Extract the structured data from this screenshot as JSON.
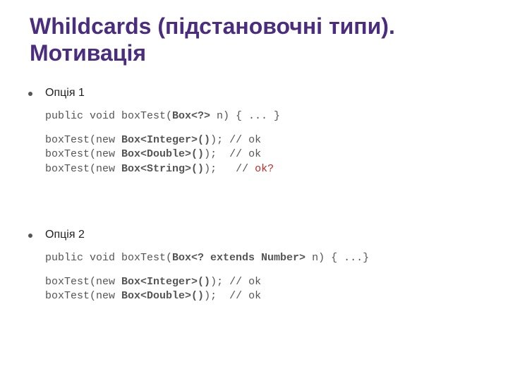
{
  "title": "Whildcards (підстановочні типи). Мотивація",
  "opt1": {
    "label": "Опція 1",
    "sig_pre": "public void boxTest(",
    "sig_bold": "Box<?>",
    "sig_post": " n) { ... }",
    "l1_pre": "boxTest(new ",
    "l1_bold": "Box<Integer>()",
    "l1_post": "); // ok",
    "l2_pre": "boxTest(new ",
    "l2_bold": "Box<Double>()",
    "l2_post": ");  // ok",
    "l3_pre": "boxTest(new ",
    "l3_bold": "Box<String>()",
    "l3_post_a": ");   // ",
    "l3_post_b": "ok?"
  },
  "opt2": {
    "label": "Опція 2",
    "sig_pre": "public void boxTest(",
    "sig_bold": "Box<? extends Number>",
    "sig_post": " n) { ...}",
    "l1_pre": "boxTest(new ",
    "l1_bold": "Box<Integer>()",
    "l1_post": "); // ok",
    "l2_pre": "boxTest(new ",
    "l2_bold": "Box<Double>()",
    "l2_post": ");  // ok"
  }
}
